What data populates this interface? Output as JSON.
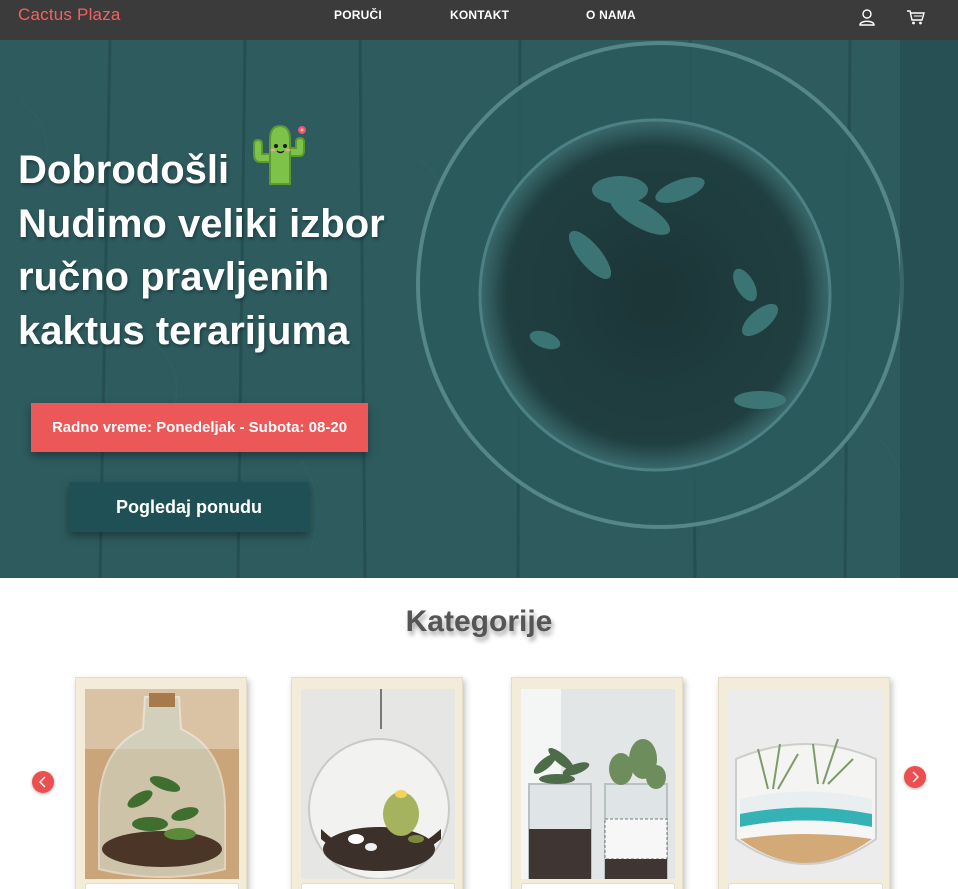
{
  "brand": {
    "name": "Cactus Plaza",
    "color": "#f0645f"
  },
  "nav": {
    "items": [
      {
        "label": "PORUČI"
      },
      {
        "label": "KONTAKT"
      },
      {
        "label": "O NAMA"
      }
    ],
    "icons": [
      "user-icon",
      "cart-icon"
    ]
  },
  "hero": {
    "title_line1": "Dobrodošli",
    "title_rest": "Nudimo veliki izbor ručno pravljenih kaktus terarijuma",
    "hours": "Radno vreme: Ponedeljak - Subota: 08-20",
    "cta": "Pogledaj ponudu",
    "colors": {
      "overlay": "#2a5457",
      "badge": "#ec5757",
      "button": "#1f5055"
    }
  },
  "categories": {
    "title": "Kategorije",
    "cards": [
      {
        "image": "bottle-terrarium"
      },
      {
        "image": "hanging-globe-terrarium"
      },
      {
        "image": "mason-jar-succulents"
      },
      {
        "image": "sand-bowl-terrarium"
      }
    ],
    "arrows": [
      "chevron-left-icon",
      "chevron-right-icon"
    ],
    "arrow_color": "#ec4f4f"
  }
}
